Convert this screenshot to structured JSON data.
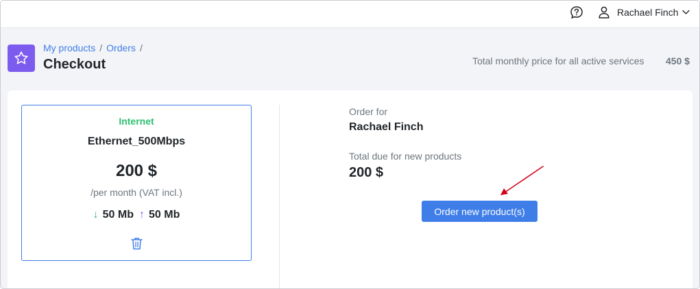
{
  "header": {
    "help_icon": "help-circle-icon",
    "user_icon": "user-icon",
    "user_name": "Rachael Finch",
    "menu_icon": "chevron-down-icon"
  },
  "page": {
    "badge_icon": "star-icon",
    "breadcrumb": [
      {
        "label": "My products"
      },
      {
        "label": "Orders"
      }
    ],
    "breadcrumb_separator": "/",
    "title": "Checkout",
    "total_label": "Total monthly price for all active services",
    "total_value": "450 $"
  },
  "product": {
    "category": "Internet",
    "name": "Ethernet_500Mbps",
    "price": "200 $",
    "period": "/per month (VAT incl.)",
    "download": "50 Mb",
    "upload": "50 Mb",
    "download_icon": "arrow-down-icon",
    "upload_icon": "arrow-up-icon",
    "delete_icon": "trash-icon"
  },
  "summary": {
    "order_for_label": "Order for",
    "order_for_name": "Rachael Finch",
    "total_due_label": "Total due for new products",
    "total_due_value": "200 $",
    "order_button_label": "Order new product(s)"
  },
  "colors": {
    "accent": "#3f7ee8",
    "badge": "#7c5cef",
    "category_green": "#2fbf71",
    "annotation_arrow": "#d0021b"
  }
}
